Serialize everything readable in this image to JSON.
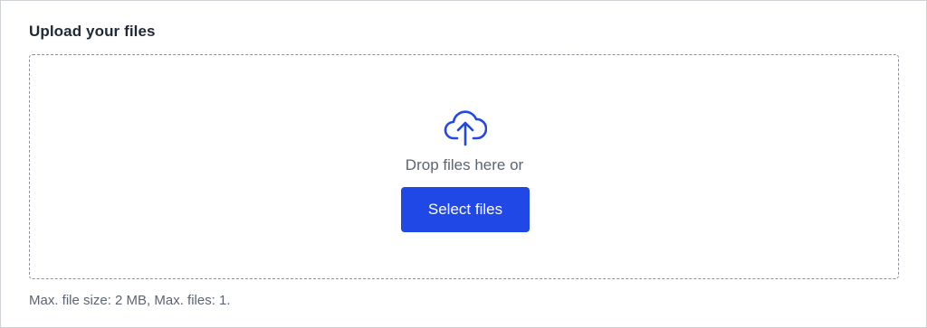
{
  "upload": {
    "title": "Upload your files",
    "drop_text": "Drop files here or",
    "select_button_label": "Select files",
    "help_text": "Max. file size: 2 MB, Max. files: 1.",
    "icon": "cloud-upload-icon",
    "accent_color": "#1f48e6"
  }
}
